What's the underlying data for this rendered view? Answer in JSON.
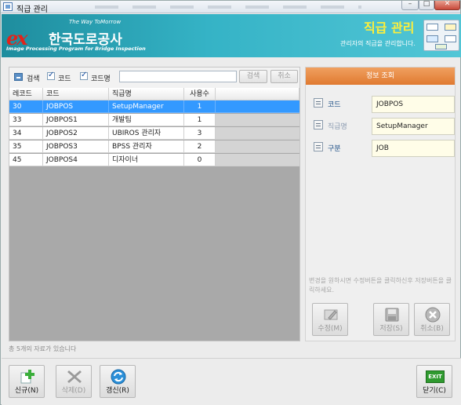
{
  "window": {
    "title": "직급 관리"
  },
  "banner": {
    "tagline": "The Way ToMorrow",
    "logo_ex": "ex",
    "logo_korean": "한국도로공사",
    "subtitle": "Image Processing Program for Bridge Inspection",
    "page_title": "직급 관리",
    "page_desc": "관리자의 직급을 관리합니다."
  },
  "search": {
    "label": "검색",
    "code_checkbox_label": "코드",
    "codename_checkbox_label": "코드명",
    "input_value": "",
    "search_button": "검색",
    "cancel_button": "취소"
  },
  "grid": {
    "columns": [
      "레코드",
      "코드",
      "직급명",
      "사용수"
    ],
    "rows": [
      {
        "record": "30",
        "code": "JOBPOS",
        "name": "SetupManager",
        "count": "1"
      },
      {
        "record": "33",
        "code": "JOBPOS1",
        "name": "개발팀",
        "count": "1"
      },
      {
        "record": "34",
        "code": "JOBPOS2",
        "name": "UBIROS 관리자",
        "count": "3"
      },
      {
        "record": "35",
        "code": "JOBPOS3",
        "name": "BPSS 관리자",
        "count": "2"
      },
      {
        "record": "45",
        "code": "JOBPOS4",
        "name": "디자이너",
        "count": "0"
      }
    ],
    "selected_index": 0
  },
  "status": {
    "record_count_text": "총 5개의 자료가 있습니다"
  },
  "info": {
    "header": "정보 조회",
    "code_label": "코드",
    "code_value": "JOBPOS",
    "name_label": "직급명",
    "name_value": "SetupManager",
    "type_label": "구분",
    "type_value": "JOB",
    "hint": "변경을 원하시면 수정버튼을 클릭하신후 저장버튼을 클릭하세요.",
    "edit_button": "수정(M)",
    "save_button": "저장(S)",
    "cancel_button": "취소(B)"
  },
  "actions": {
    "new_button": "신규(N)",
    "delete_button": "삭제(D)",
    "refresh_button": "갱신(R)",
    "close_button": "닫기(C)",
    "exit_icon_text": "EXIT"
  },
  "colors": {
    "selection": "#3399ff",
    "banner": "#35b3c6",
    "info_header": "#e88a40",
    "field_bg": "#fffde8"
  }
}
